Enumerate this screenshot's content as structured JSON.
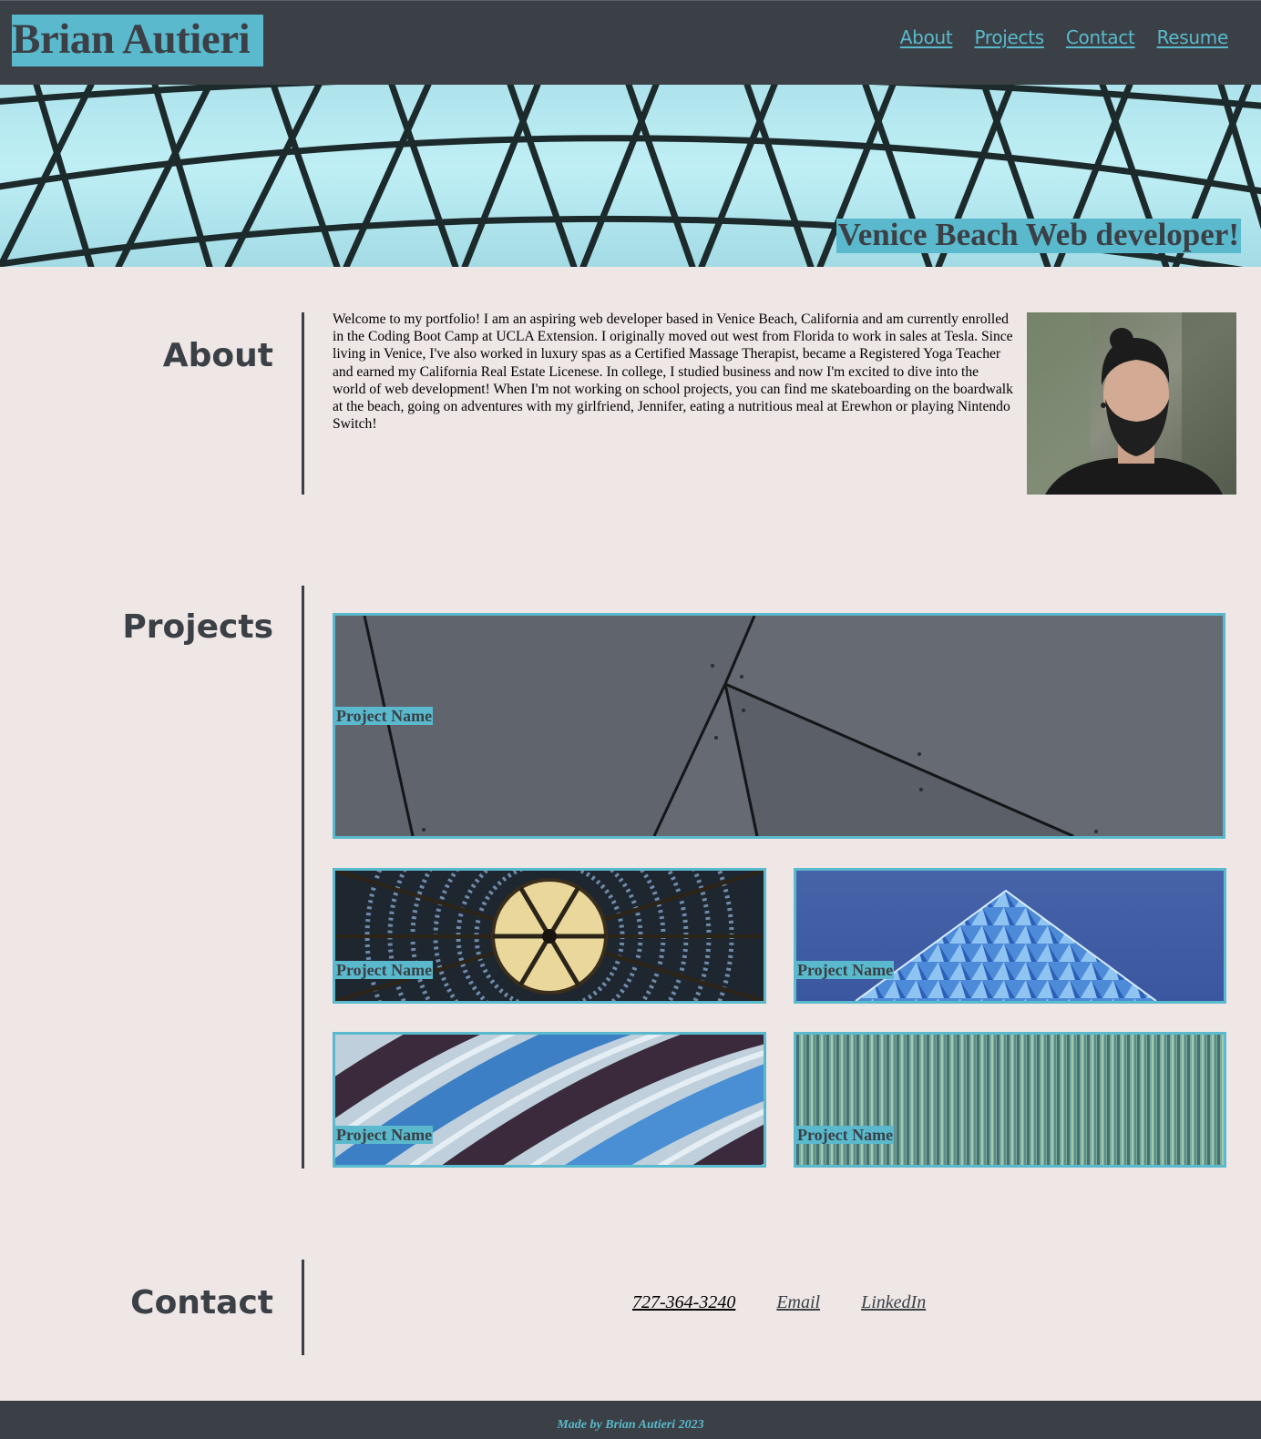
{
  "header": {
    "site_title": "Brian Autieri",
    "nav": [
      {
        "label": "About"
      },
      {
        "label": "Projects"
      },
      {
        "label": "Contact"
      },
      {
        "label": "Resume"
      }
    ]
  },
  "hero": {
    "tagline": "Venice Beach Web developer!"
  },
  "about": {
    "heading": "About",
    "body": "Welcome to my portfolio! I am an aspiring web developer based in Venice Beach, California and am currently enrolled in the Coding Boot Camp at UCLA Extension. I originally moved out west from Florida to work in sales at Tesla. Since living in Venice, I've also worked in luxury spas as a Certified Massage Therapist, became a Registered Yoga Teacher and earned my California Real Estate Licenese. In college, I studied business and now I'm excited to dive into the world of web development! When I'm not working on school projects, you can find me skateboarding on the boardwalk at the beach, going on adventures with my girlfriend, Jennifer, eating a nutritious meal at Erewhon or playing Nintendo Switch!"
  },
  "projects": {
    "heading": "Projects",
    "items": [
      {
        "name": "Project Name"
      },
      {
        "name": "Project Name"
      },
      {
        "name": "Project Name"
      },
      {
        "name": "Project Name"
      },
      {
        "name": "Project Name"
      }
    ]
  },
  "contact": {
    "heading": "Contact",
    "phone": "727-364-3240",
    "email_label": "Email",
    "linkedin_label": "LinkedIn"
  },
  "footer": {
    "text": "Made by Brian Autieri 2023"
  },
  "colors": {
    "header_bg": "#3a4045",
    "accent": "#5ab9cd",
    "page_bg": "#efe6e6"
  }
}
